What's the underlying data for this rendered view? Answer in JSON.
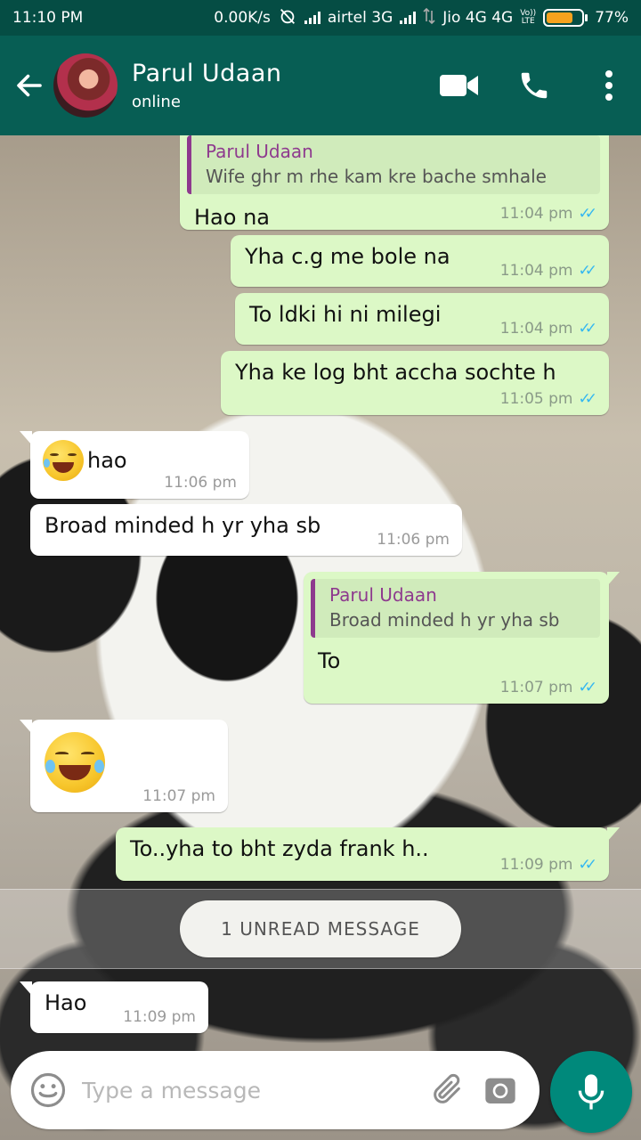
{
  "status_bar": {
    "time": "11:10 PM",
    "speed": "0.00K/s",
    "carrier1": "airtel 3G",
    "carrier2": "Jio 4G 4G",
    "volte_top": "Vo))",
    "volte_bottom": "LTE",
    "battery": "77%",
    "battery_level": 0.77
  },
  "header": {
    "contact_name": "Parul Udaan",
    "status": "online",
    "icons": [
      "back-arrow-icon",
      "video-call-icon",
      "phone-icon",
      "more-vert-icon"
    ]
  },
  "messages": [
    {
      "id": "m1",
      "direction": "out",
      "quote_name": "Parul Udaan",
      "quote_text": "Wife ghr m rhe kam kre bache smhale",
      "text": "Hao na",
      "time": "11:04 pm",
      "read": true
    },
    {
      "id": "m2",
      "direction": "out",
      "text": "Yha c.g me bole na",
      "time": "11:04 pm",
      "read": true
    },
    {
      "id": "m3",
      "direction": "out",
      "text": "To ldki hi ni milegi",
      "time": "11:04 pm",
      "read": true
    },
    {
      "id": "m4",
      "direction": "out",
      "text": "Yha ke log bht accha sochte h",
      "time": "11:05 pm",
      "read": true
    },
    {
      "id": "m5",
      "direction": "in",
      "emoji": "rolling-on-floor-laughing",
      "text": "hao",
      "time": "11:06 pm"
    },
    {
      "id": "m6",
      "direction": "in",
      "text": "Broad minded h yr yha sb",
      "time": "11:06 pm"
    },
    {
      "id": "m7",
      "direction": "out",
      "quote_name": "Parul Udaan",
      "quote_text": "Broad minded h yr yha sb",
      "text": "To",
      "time": "11:07 pm",
      "read": true
    },
    {
      "id": "m8",
      "direction": "in",
      "emoji": "rolling-on-floor-laughing",
      "text": "",
      "time": "11:07 pm"
    },
    {
      "id": "m9",
      "direction": "out",
      "text": "To..yha to bht zyda frank h..",
      "time": "11:09 pm",
      "read": true
    },
    {
      "id": "m10",
      "direction": "in",
      "text": "Hao",
      "time": "11:09 pm"
    }
  ],
  "unread_divider": "1 UNREAD MESSAGE",
  "composer": {
    "placeholder": "Type a message",
    "value": "",
    "icons": [
      "emoji-icon",
      "attach-icon",
      "camera-icon",
      "mic-icon"
    ]
  },
  "colors": {
    "header": "#075e54",
    "statusbar": "#054d44",
    "outgoing_bubble": "#dcf8c6",
    "incoming_bubble": "#ffffff",
    "read_ticks": "#34b7f1",
    "accent": "#00897b",
    "quote_accent": "#8e3a8e"
  }
}
